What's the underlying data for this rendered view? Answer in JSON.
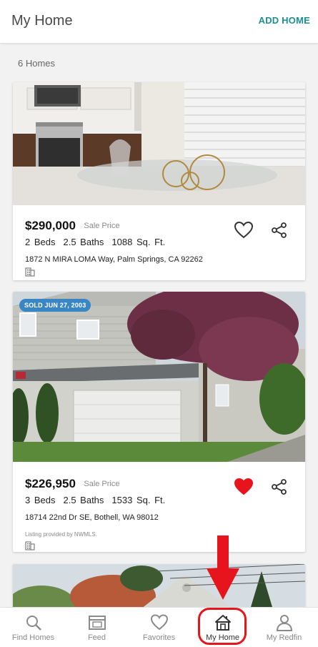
{
  "header": {
    "title": "My Home",
    "add_home_label": "ADD HOME"
  },
  "home_count": "6 Homes",
  "listings": [
    {
      "price": "$290,000",
      "price_label": "Sale Price",
      "beds": "2 Beds",
      "baths": "2.5 Baths",
      "sqft": "1088 Sq. Ft.",
      "address": "1872 N MIRA LOMA Way, Palm Springs, CA 92262",
      "favorited": false
    },
    {
      "badge": "SOLD JUN 27, 2003",
      "price": "$226,950",
      "price_label": "Sale Price",
      "beds": "3 Beds",
      "baths": "2.5 Baths",
      "sqft": "1533 Sq. Ft.",
      "address": "18714 22nd Dr SE, Bothell, WA 98012",
      "provided_by": "Listing provided by NWMLS.",
      "favorited": true
    }
  ],
  "bottom_nav": {
    "items": [
      {
        "label": "Find Homes",
        "icon": "search-icon"
      },
      {
        "label": "Feed",
        "icon": "feed-icon"
      },
      {
        "label": "Favorites",
        "icon": "heart-icon"
      },
      {
        "label": "My Home",
        "icon": "house-icon",
        "active": true
      },
      {
        "label": "My Redfin",
        "icon": "person-icon"
      }
    ]
  },
  "colors": {
    "accent_teal": "#1b8f93",
    "favorite_red": "#e8141d",
    "annotation_red": "#e8141d",
    "sold_badge_blue": "#3a86c4"
  }
}
